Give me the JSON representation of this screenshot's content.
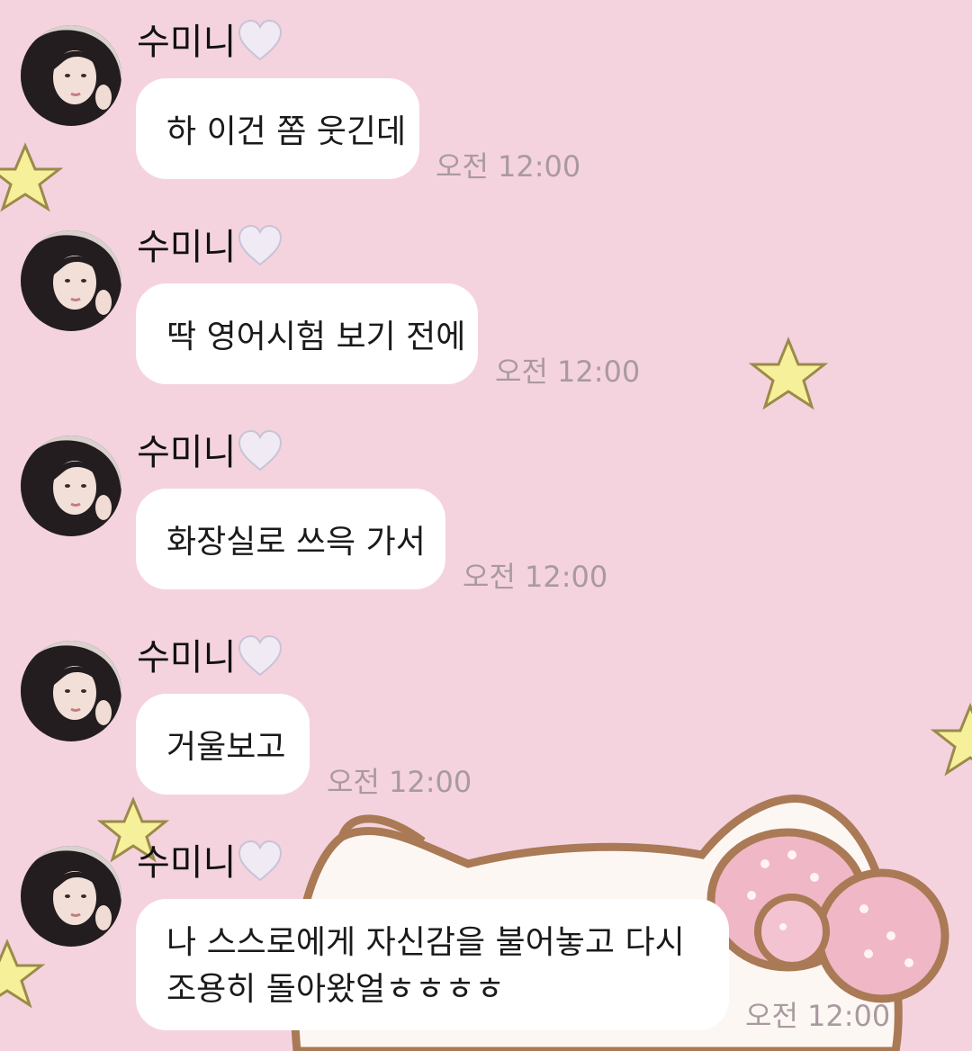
{
  "chat": {
    "messages": [
      {
        "sender": "수미니",
        "text": "하 이건 쫌 웃긴데",
        "time": "오전 12:00"
      },
      {
        "sender": "수미니",
        "text": "딱 영어시험 보기 전에",
        "time": "오전 12:00"
      },
      {
        "sender": "수미니",
        "text": "화장실로 쓰윽 가서",
        "time": "오전 12:00"
      },
      {
        "sender": "수미니",
        "text": "거울보고",
        "time": "오전 12:00"
      },
      {
        "sender": "수미니",
        "text": "나 스스로에게 자신감을 불어놓고 다시 조용히 돌아왔얼ㅎㅎㅎㅎ",
        "time": "오전 12:00"
      }
    ]
  },
  "icons": {
    "avatar": "profile-photo",
    "heart": "white-heart-emoji"
  },
  "colors": {
    "background": "#f4d3df",
    "bubble": "#ffffff",
    "timestamp": "#a99aa0"
  }
}
